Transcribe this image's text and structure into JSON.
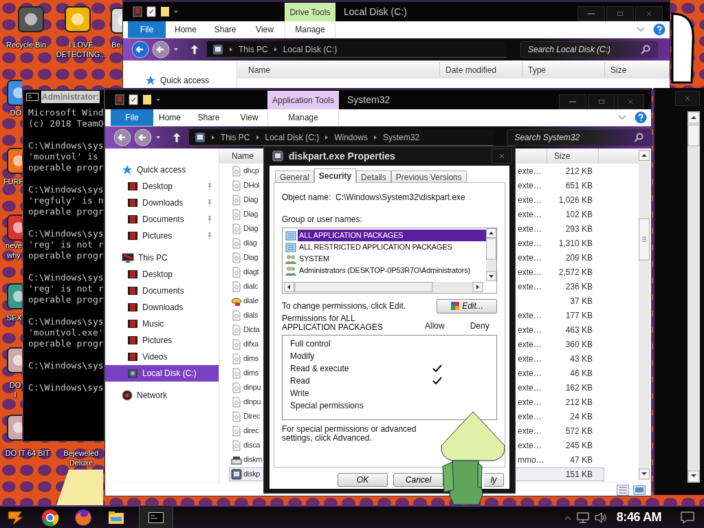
{
  "desktop": {
    "icons": [
      {
        "label": "Recycle Bin"
      },
      {
        "label": "I LOVE DETECTING..."
      },
      {
        "label": "Be"
      },
      {
        "label": "DO"
      },
      {
        "label": "FURF"
      },
      {
        "label": "neve why"
      },
      {
        "label": "SEX"
      },
      {
        "label": "DO I"
      },
      {
        "label": "DO IT 64 BIT"
      },
      {
        "label": "Bejeweled Deluxe"
      }
    ]
  },
  "back_explorer": {
    "title": "Local Disk (C:)",
    "context_tab": {
      "label": "Drive Tools",
      "color": "#c8eeaa"
    },
    "ribbon_tabs": [
      {
        "label": "File",
        "kind": "file"
      },
      {
        "label": "Home",
        "kind": "tab"
      },
      {
        "label": "Share",
        "kind": "tab"
      },
      {
        "label": "View",
        "kind": "tab"
      },
      {
        "label": "Manage",
        "kind": "context"
      }
    ],
    "breadcrumbs": [
      "This PC",
      "Local Disk (C:)"
    ],
    "search": {
      "placeholder": "Search Local Disk (C:)"
    },
    "nav": [
      {
        "label": "Quick access",
        "kind": "quick"
      }
    ],
    "columns": [
      "Name",
      "Date modified",
      "Type",
      "Size"
    ]
  },
  "cmd_window": {
    "title": "Administrator:",
    "blocks": [
      [
        "Microsoft Wind",
        "(c) 2018 TeamO"
      ],
      [
        "C:\\Windows\\sys",
        "'mountvol' is",
        "operable progr"
      ],
      [
        "C:\\Windows\\sys",
        "'regfuly' is n",
        "operable progr"
      ],
      [
        "C:\\Windows\\sys",
        "'reg' is not r",
        "operable progr"
      ],
      [
        "C:\\Windows\\sys",
        "'reg' is not r",
        "operable progr"
      ],
      [
        "C:\\Windows\\sys",
        "'mountvol.exe'",
        "operable progr"
      ],
      [
        "C:\\Windows\\sys"
      ],
      [
        "C:\\Windows\\sys"
      ]
    ]
  },
  "front_explorer": {
    "title": "System32",
    "context_tab": {
      "label": "Application Tools",
      "color": "#e4c9f2"
    },
    "ribbon_tabs": [
      {
        "label": "File",
        "kind": "file"
      },
      {
        "label": "Home",
        "kind": "tab"
      },
      {
        "label": "Share",
        "kind": "tab"
      },
      {
        "label": "View",
        "kind": "tab"
      },
      {
        "label": "Manage",
        "kind": "context"
      }
    ],
    "breadcrumbs": [
      "This PC",
      "Local Disk (C:)",
      "Windows",
      "System32"
    ],
    "search": {
      "placeholder": "Search System32"
    },
    "nav": [
      {
        "label": "Quick access",
        "kind": "quick",
        "children": [
          {
            "label": "Desktop",
            "kind": "folder",
            "pinned": true,
            "selected": false
          },
          {
            "label": "Downloads",
            "kind": "folder",
            "pinned": true,
            "selected": false
          },
          {
            "label": "Documents",
            "kind": "folder",
            "pinned": true,
            "selected": false
          },
          {
            "label": "Pictures",
            "kind": "folder",
            "pinned": true,
            "selected": false
          }
        ]
      },
      {
        "label": "This PC",
        "kind": "pc",
        "children": [
          {
            "label": "Desktop",
            "kind": "folder",
            "pinned": false,
            "selected": false
          },
          {
            "label": "Documents",
            "kind": "folder",
            "pinned": false,
            "selected": false
          },
          {
            "label": "Downloads",
            "kind": "folder",
            "pinned": false,
            "selected": false
          },
          {
            "label": "Music",
            "kind": "folder",
            "pinned": false,
            "selected": false
          },
          {
            "label": "Pictures",
            "kind": "folder",
            "pinned": false,
            "selected": false
          },
          {
            "label": "Videos",
            "kind": "folder",
            "pinned": false,
            "selected": false
          },
          {
            "label": "Local Disk (C:)",
            "kind": "disk",
            "pinned": false,
            "selected": true
          }
        ]
      },
      {
        "label": "Network",
        "kind": "network"
      }
    ],
    "columns": [
      "Name",
      "Size"
    ],
    "rows": [
      {
        "name": "dhcp",
        "kind": "file",
        "type": "exte…",
        "size": "212 KB",
        "selected": false
      },
      {
        "name": "DHol",
        "kind": "file",
        "type": "exte…",
        "size": "651 KB",
        "selected": false
      },
      {
        "name": "Diag",
        "kind": "file",
        "type": "exte…",
        "size": "1,026 KB",
        "selected": false
      },
      {
        "name": "Diag",
        "kind": "file",
        "type": "exte…",
        "size": "102 KB",
        "selected": false
      },
      {
        "name": "Diag",
        "kind": "file",
        "type": "exte…",
        "size": "293 KB",
        "selected": false
      },
      {
        "name": "diag",
        "kind": "file",
        "type": "exte…",
        "size": "1,310 KB",
        "selected": false
      },
      {
        "name": "Diag",
        "kind": "file",
        "type": "exte…",
        "size": "209 KB",
        "selected": false
      },
      {
        "name": "diagt",
        "kind": "file",
        "type": "exte…",
        "size": "2,572 KB",
        "selected": false
      },
      {
        "name": "dialc",
        "kind": "file",
        "type": "exte…",
        "size": "236 KB",
        "selected": false
      },
      {
        "name": "diale",
        "kind": "phone",
        "size": "37 KB",
        "selected": false
      },
      {
        "name": "dials",
        "kind": "file",
        "type": "exte…",
        "size": "177 KB",
        "selected": false
      },
      {
        "name": "Dicta",
        "kind": "file",
        "type": "exte…",
        "size": "463 KB",
        "selected": false
      },
      {
        "name": "difxa",
        "kind": "file",
        "type": "exte…",
        "size": "360 KB",
        "selected": false
      },
      {
        "name": "dims",
        "kind": "file",
        "type": "exte…",
        "size": "43 KB",
        "selected": false
      },
      {
        "name": "dims",
        "kind": "file",
        "type": "exte…",
        "size": "46 KB",
        "selected": false
      },
      {
        "name": "dinpu",
        "kind": "file",
        "type": "exte…",
        "size": "162 KB",
        "selected": false
      },
      {
        "name": "dinpu",
        "kind": "file",
        "type": "exte…",
        "size": "212 KB",
        "selected": false
      },
      {
        "name": "Direc",
        "kind": "file",
        "type": "exte…",
        "size": "24 KB",
        "selected": false
      },
      {
        "name": "direc",
        "kind": "file",
        "type": "exte…",
        "size": "572 KB",
        "selected": false
      },
      {
        "name": "disca",
        "kind": "file",
        "type": "exte…",
        "size": "245 KB",
        "selected": false
      },
      {
        "name": "diskm",
        "kind": "drive",
        "type": "mmo…",
        "size": "47 KB",
        "selected": false
      },
      {
        "name": "diskp",
        "kind": "app",
        "size": "151 KB",
        "selected": true
      }
    ]
  },
  "properties_dialog": {
    "title": "diskpart.exe Properties",
    "tabs": [
      {
        "label": "General",
        "selected": false
      },
      {
        "label": "Security",
        "selected": true
      },
      {
        "label": "Details",
        "selected": false
      },
      {
        "label": "Previous Versions",
        "selected": false
      }
    ],
    "object_name": {
      "label": "Object name:",
      "value": "C:\\Windows\\System32\\diskpart.exe"
    },
    "group_label": "Group or user names:",
    "groups": [
      {
        "name": "ALL APPLICATION PACKAGES",
        "kind": "package",
        "selected": true
      },
      {
        "name": "ALL RESTRICTED APPLICATION PACKAGES",
        "kind": "package",
        "selected": false
      },
      {
        "name": "SYSTEM",
        "kind": "users",
        "selected": false
      },
      {
        "name": "Administrators (DESKTOP-0P53R7O\\Administrators)",
        "kind": "users",
        "selected": false
      }
    ],
    "change_hint": "To change permissions, click Edit.",
    "edit_button": "Edit...",
    "permissions_label": "Permissions for ALL APPLICATION PACKAGES",
    "allow_header": "Allow",
    "deny_header": "Deny",
    "permissions": [
      {
        "name": "Full control",
        "allow": false,
        "deny": false
      },
      {
        "name": "Modify",
        "allow": false,
        "deny": false
      },
      {
        "name": "Read & execute",
        "allow": true,
        "deny": false
      },
      {
        "name": "Read",
        "allow": true,
        "deny": false
      },
      {
        "name": "Write",
        "allow": false,
        "deny": false
      },
      {
        "name": "Special permissions",
        "allow": false,
        "deny": false
      }
    ],
    "advanced_hint": "For special permissions or advanced settings, click Advanced.",
    "buttons": [
      {
        "label": "OK"
      },
      {
        "label": "Cancel"
      },
      {
        "label": "ly"
      }
    ]
  },
  "taskbar": {
    "clock": "8:46 AM"
  }
}
